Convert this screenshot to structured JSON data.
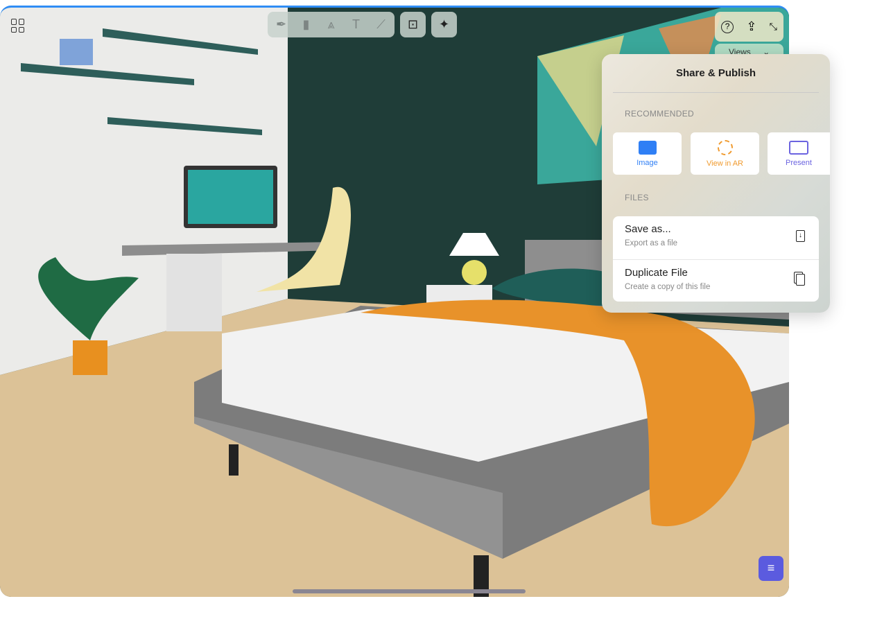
{
  "toolbar": {
    "tools": [
      "pen-icon",
      "marker-icon",
      "pencil-icon",
      "text-icon",
      "ruler-icon"
    ],
    "present_icon": "presentation-icon",
    "ai_icon": "sparkles-icon"
  },
  "top_right": {
    "icons": [
      "help-icon",
      "share-icon",
      "collapse-icon"
    ],
    "views_label": "Views"
  },
  "popover": {
    "title": "Share & Publish",
    "recommended_label": "RECOMMENDED",
    "cards": [
      {
        "label": "Image",
        "color": "#2f7ff5"
      },
      {
        "label": "View in AR",
        "color": "#f09a2e"
      },
      {
        "label": "Present",
        "color": "#6b63e0"
      }
    ],
    "files_label": "FILES",
    "files": [
      {
        "title": "Save as...",
        "subtitle": "Export as a file"
      },
      {
        "title": "Duplicate File",
        "subtitle": "Create a copy of this file"
      }
    ]
  },
  "menu_button_color": "#5b5bdf"
}
